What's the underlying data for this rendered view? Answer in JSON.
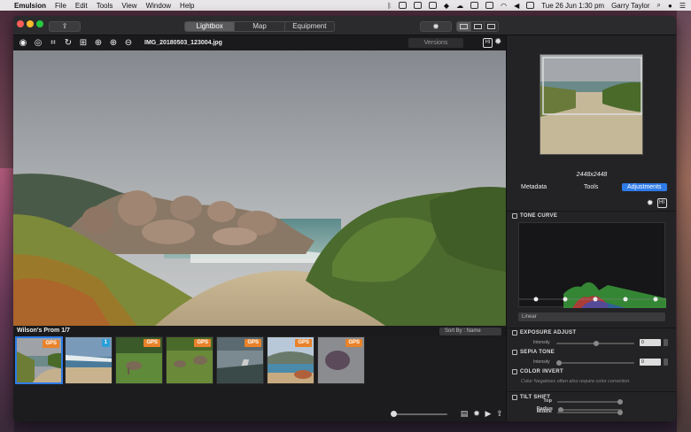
{
  "menubar": {
    "app_name": "Emulsion",
    "menus": [
      "File",
      "Edit",
      "Tools",
      "View",
      "Window",
      "Help"
    ],
    "datetime": "Tue 26 Jun  1:30 pm",
    "user": "Garry Taylor"
  },
  "titlebar": {
    "tabs": [
      {
        "label": "Lightbox",
        "active": true
      },
      {
        "label": "Map",
        "active": false
      },
      {
        "label": "Equipment",
        "active": false
      }
    ]
  },
  "toolbar": {
    "filename": "IMG_20180503_123004.jpg",
    "versions_label": "Versions",
    "hist_label": "HI"
  },
  "filmstrip": {
    "album_title": "Wilson's Prom 1/7",
    "sort_label": "Sort By : Name",
    "thumbnails": [
      {
        "badge": "GPS",
        "selected": true
      },
      {
        "badge": "1",
        "selected": false
      },
      {
        "badge": "GPS",
        "selected": false
      },
      {
        "badge": "GPS",
        "selected": false
      },
      {
        "badge": "GPS",
        "selected": false
      },
      {
        "badge": "GPS",
        "selected": false
      },
      {
        "badge": "GPS",
        "selected": false
      }
    ]
  },
  "rpanel": {
    "dimensions": "2448x2448",
    "tabs": [
      {
        "label": "Metadata",
        "active": false
      },
      {
        "label": "Tools",
        "active": false
      },
      {
        "label": "Adjustments",
        "active": true
      }
    ],
    "hist_label": "HI",
    "tone_curve": {
      "title": "TONE CURVE",
      "mode": "Linear"
    },
    "exposure": {
      "title": "EXPOSURE ADJUST",
      "slider_label": "Intensity",
      "value": "0"
    },
    "sepia": {
      "title": "SEPIA TONE",
      "slider_label": "Intensity",
      "value": "0"
    },
    "color_invert": {
      "title": "COLOR INVERT",
      "note": "Color Negatives often also require color correction."
    },
    "tilt_shift": {
      "title": "TILT SHIFT",
      "labels": [
        "Radius",
        "Top",
        "Middle"
      ]
    }
  },
  "colors": {
    "accent": "#2f7be8",
    "gps_badge": "#e9822a",
    "count_badge": "#2d9fd8"
  }
}
